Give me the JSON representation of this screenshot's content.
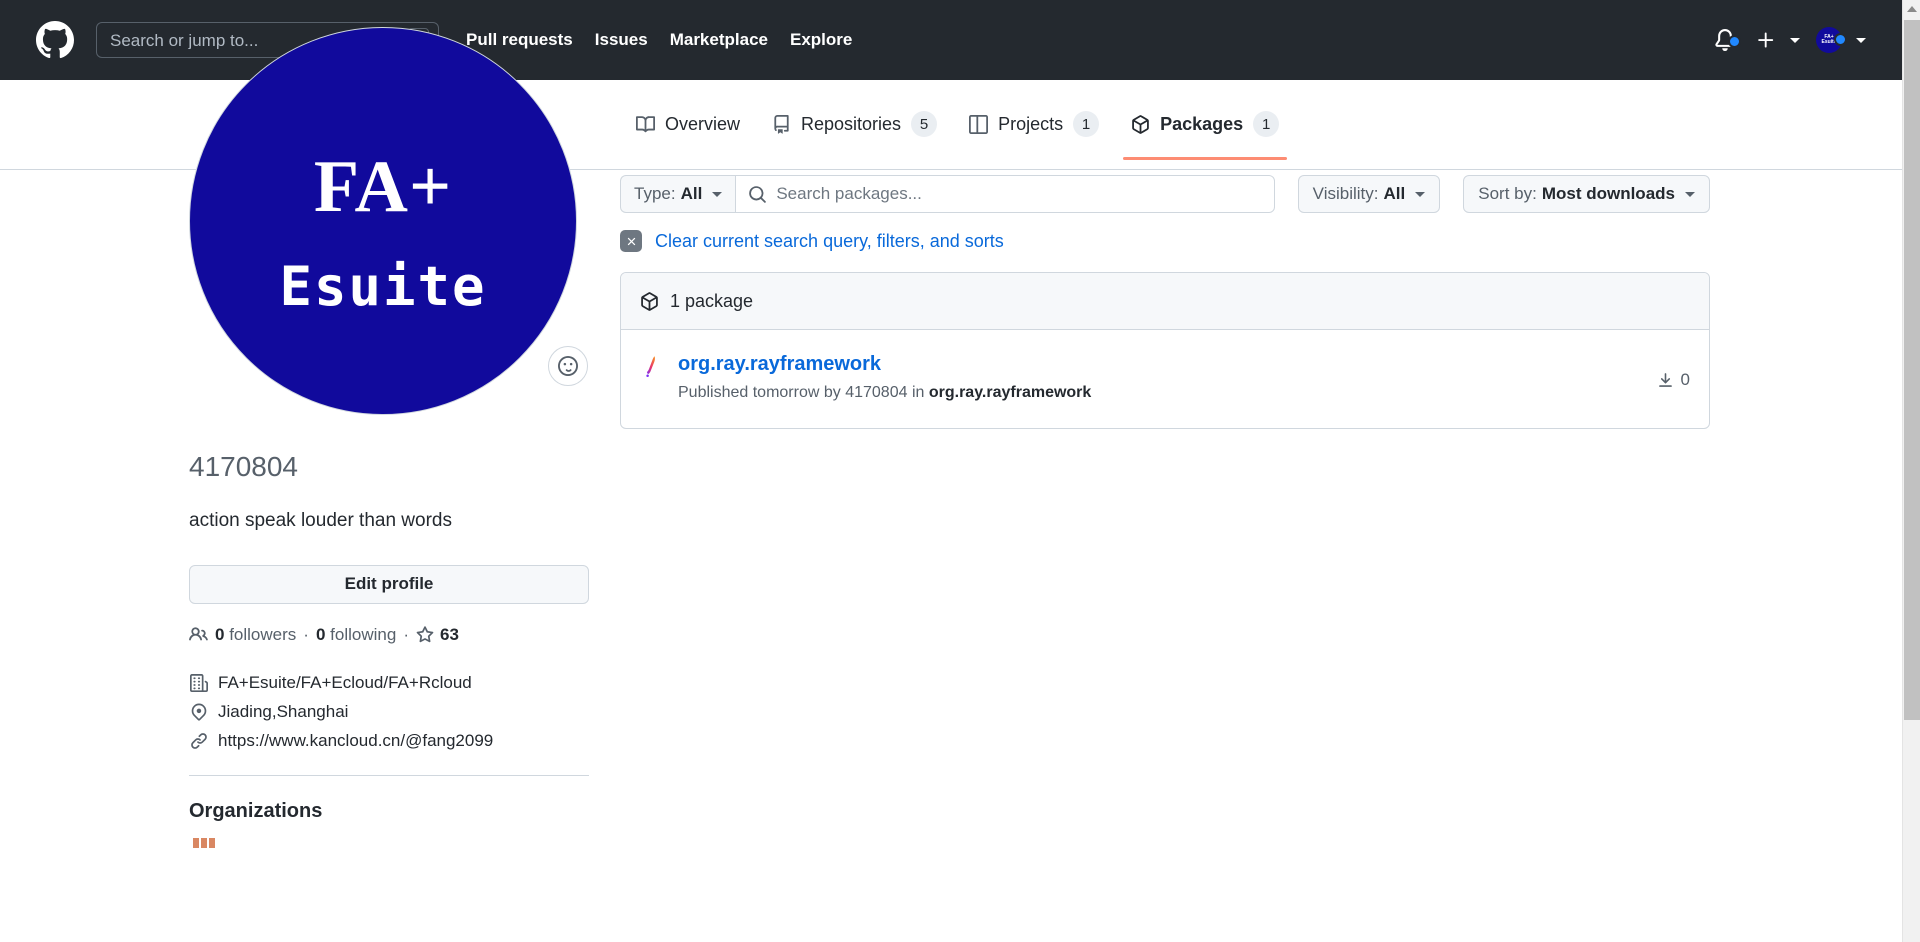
{
  "header": {
    "logo_icon": "github-mark-icon",
    "search": {
      "placeholder": "Search or jump to...",
      "value": "",
      "shortcut_key": "/"
    },
    "nav": [
      {
        "label": "Pull requests"
      },
      {
        "label": "Issues"
      },
      {
        "label": "Marketplace"
      },
      {
        "label": "Explore"
      }
    ],
    "notifications_icon": "bell-icon",
    "has_unread_notifications": true,
    "create_new_icon": "plus-icon",
    "avatar_initials_top": "FA+",
    "avatar_initials_bottom": "Esuite",
    "background_color": "#24292f"
  },
  "profile": {
    "avatar": {
      "line1": "FA+",
      "line2": "Esuite",
      "background_color": "#110a9c"
    },
    "status_button_icon": "smiley-icon",
    "username": "4170804",
    "bio": "action speak louder than words",
    "edit_profile_label": "Edit profile",
    "stats": {
      "followers_count": "0",
      "followers_label": "followers",
      "following_count": "0",
      "following_label": "following",
      "stars_count": "63"
    },
    "details": [
      {
        "icon": "organization-icon",
        "text": "FA+Esuite/FA+Ecloud/FA+Rcloud"
      },
      {
        "icon": "location-icon",
        "text": "Jiading,Shanghai"
      },
      {
        "icon": "link-icon",
        "text": "https://www.kancloud.cn/@fang2099"
      }
    ],
    "organizations_title": "Organizations",
    "organization_avatar_color": "#d98762"
  },
  "tabs": [
    {
      "icon": "book-icon",
      "label": "Overview",
      "count": null,
      "active": false
    },
    {
      "icon": "repo-icon",
      "label": "Repositories",
      "count": "5",
      "active": false
    },
    {
      "icon": "project-icon",
      "label": "Projects",
      "count": "1",
      "active": false
    },
    {
      "icon": "package-icon",
      "label": "Packages",
      "count": "1",
      "active": true
    }
  ],
  "filters": {
    "type": {
      "prefix": "Type:",
      "value": "All"
    },
    "search": {
      "placeholder": "Search packages...",
      "value": ""
    },
    "visibility": {
      "prefix": "Visibility:",
      "value": "All"
    },
    "sort": {
      "prefix": "Sort by:",
      "value": "Most downloads"
    },
    "clear_label": "Clear current search query, filters, and sorts"
  },
  "packages_box": {
    "header_label": "1 package",
    "rows": [
      {
        "ecosystem_icon": "maven-icon",
        "name": "org.ray.rayframework",
        "subtitle_prefix": "Published tomorrow by",
        "subtitle_author": "4170804",
        "subtitle_mid": "in",
        "subtitle_repo": "org.ray.rayframework",
        "downloads_icon": "download-icon",
        "downloads": "0"
      }
    ]
  },
  "colors": {
    "accent_blue": "#0969da",
    "active_tab_underline": "#fd8c73",
    "header_bg": "#24292f",
    "border": "#d0d7de",
    "muted_text": "#57606a"
  }
}
